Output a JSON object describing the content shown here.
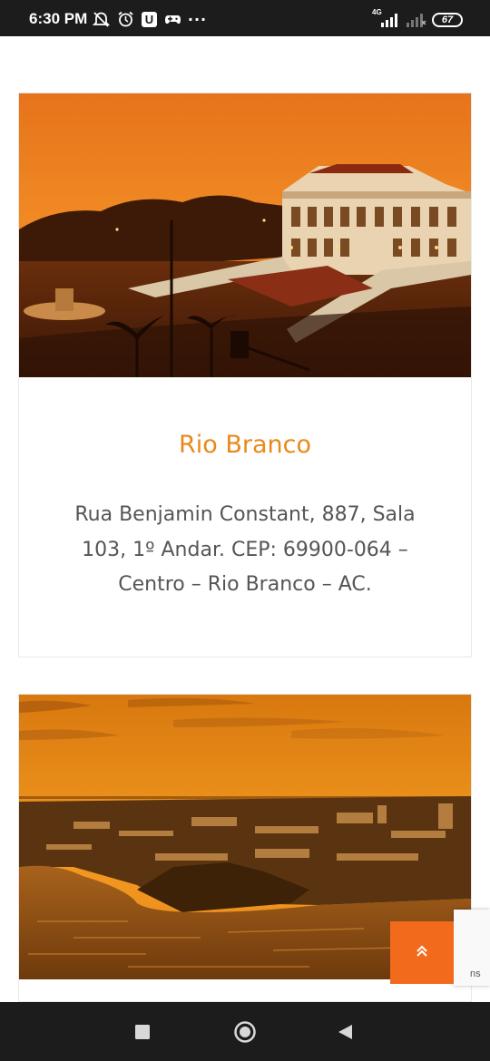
{
  "status_bar": {
    "time": "6:30 PM",
    "network": "4G",
    "battery": "67",
    "icons_left": [
      "do-not-disturb-icon",
      "alarm-icon",
      "u-app-icon",
      "game-controller-icon",
      "more-dots-icon"
    ],
    "icons_right": [
      "signal-icon",
      "signal-no-data-icon",
      "battery-icon"
    ]
  },
  "locations": [
    {
      "title": "Rio Branco",
      "address": "Rua Benjamin Constant, 887, Sala 103, 1º Andar. CEP: 69900-064 – Centro – Rio Branco – AC."
    },
    {
      "title": "",
      "address": ""
    }
  ],
  "back_to_top": {
    "icon": "double-chevron-up-icon",
    "glyph": "«"
  },
  "recaptcha": {
    "label": "ns"
  },
  "nav_bar": {
    "items": [
      "recents-icon",
      "home-icon",
      "back-icon"
    ]
  },
  "colors": {
    "accent": "#f26b1d",
    "title": "#e88a1a",
    "status_bar": "#1c1c1c"
  }
}
